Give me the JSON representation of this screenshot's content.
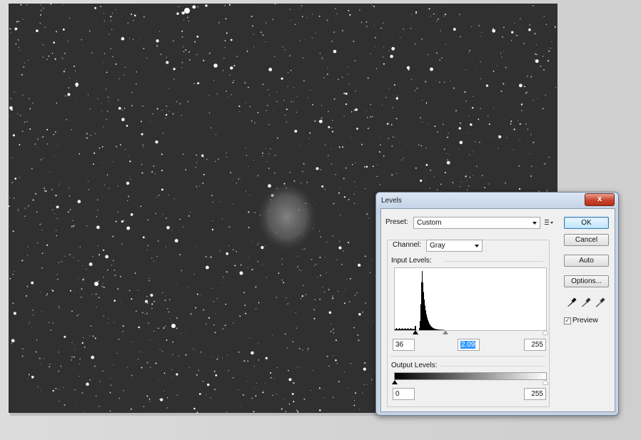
{
  "dialog": {
    "title": "Levels",
    "close_glyph": "x",
    "preset_label": "Preset:",
    "preset_value": "Custom",
    "preset_menu_icon": "preset-options-icon",
    "channel_label": "Channel:",
    "channel_value": "Gray",
    "input_levels_label": "Input Levels:",
    "input_black": "36",
    "input_gamma": "2.09",
    "input_white": "255",
    "output_levels_label": "Output Levels:",
    "output_black": "0",
    "output_white": "255",
    "buttons": {
      "ok": "OK",
      "cancel": "Cancel",
      "auto": "Auto",
      "options": "Options..."
    },
    "preview_label": "Preview",
    "preview_checked": true,
    "eyedroppers": [
      "black-point-eyedropper-icon",
      "gray-point-eyedropper-icon",
      "white-point-eyedropper-icon"
    ]
  },
  "histogram": {
    "bins_description": "strongly peaked near low values",
    "peak_value": 1.0
  },
  "colors": {
    "dialog_frame": "#c6d5e6",
    "close_button": "#c7432c",
    "canvas_background": "#303030",
    "selection": "#3399ff"
  }
}
